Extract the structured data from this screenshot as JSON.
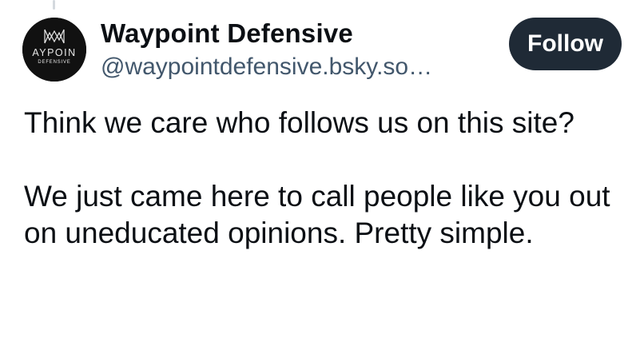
{
  "post": {
    "author": {
      "display_name": "Waypoint Defensive",
      "handle": "@waypointdefensive.bsky.so…",
      "avatar_icon": "waypoint-defensive-logo",
      "avatar_text_main": "AYPOIN",
      "avatar_text_sub": "DEFENSIVE"
    },
    "follow_label": "Follow",
    "paragraphs": [
      "Think we care who follows us on this site?",
      "We just came here to call people like you out on uneducated opinions. Pretty simple."
    ]
  },
  "colors": {
    "follow_button_bg": "#1f2a36",
    "handle_text": "#42576c",
    "body_text": "#0b0f14"
  }
}
